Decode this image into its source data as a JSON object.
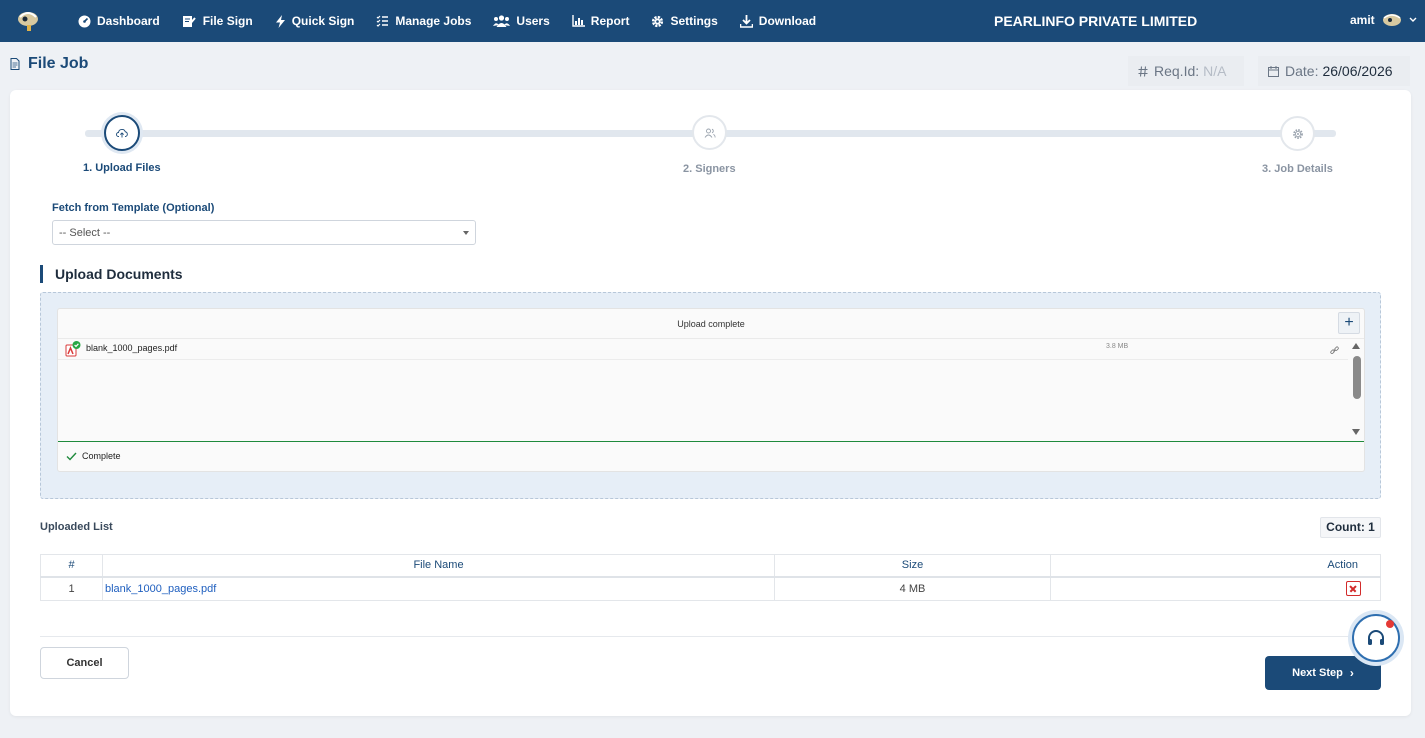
{
  "nav": {
    "items": [
      {
        "label": "Dashboard",
        "icon": "dashboard-icon"
      },
      {
        "label": "File Sign",
        "icon": "file-sign-icon"
      },
      {
        "label": "Quick Sign",
        "icon": "lightning-icon"
      },
      {
        "label": "Manage Jobs",
        "icon": "list-icon"
      },
      {
        "label": "Users",
        "icon": "users-icon"
      },
      {
        "label": "Report",
        "icon": "chart-icon"
      },
      {
        "label": "Settings",
        "icon": "gear-icon"
      },
      {
        "label": "Download",
        "icon": "download-icon"
      }
    ],
    "brand": "PEARLINFO PRIVATE LIMITED",
    "user": "amit"
  },
  "page": {
    "title": "File Job",
    "req_label": "Req.Id:",
    "req_value": "N/A",
    "date_label": "Date:",
    "date_value": "26/06/2026"
  },
  "stepper": {
    "steps": [
      {
        "label": "1. Upload Files",
        "active": true
      },
      {
        "label": "2. Signers",
        "active": false
      },
      {
        "label": "3. Job Details",
        "active": false
      }
    ]
  },
  "template": {
    "label": "Fetch from Template (Optional)",
    "selected": "-- Select --"
  },
  "upload": {
    "section_title": "Upload Documents",
    "status_header": "Upload complete",
    "add_label": "+",
    "file_name": "blank_1000_pages.pdf",
    "file_size": "3.8 MB",
    "footer_status": "Complete"
  },
  "uploaded_list": {
    "title": "Uploaded List",
    "count": "Count: 1",
    "columns": [
      "#",
      "File Name",
      "Size",
      "Action"
    ],
    "rows": [
      {
        "idx": "1",
        "name": "blank_1000_pages.pdf",
        "size": "4 MB"
      }
    ]
  },
  "actions": {
    "cancel": "Cancel",
    "next": "Next Step",
    "next_arrow": "›"
  },
  "colors": {
    "brand": "#1b4a78",
    "success": "#1f8a3c",
    "danger": "#d22b2b"
  }
}
